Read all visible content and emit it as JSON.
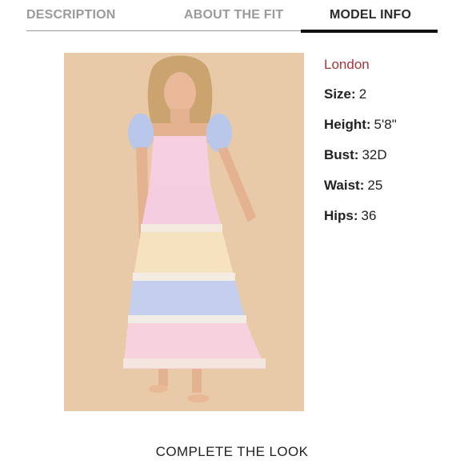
{
  "tabs": [
    {
      "label": "DESCRIPTION",
      "active": false
    },
    {
      "label": "ABOUT THE FIT",
      "active": false
    },
    {
      "label": "MODEL INFO",
      "active": true
    }
  ],
  "model": {
    "name": "London",
    "stats": [
      {
        "label": "Size:",
        "value": "2"
      },
      {
        "label": "Height:",
        "value": "5'8\""
      },
      {
        "label": "Bust:",
        "value": "32D"
      },
      {
        "label": "Waist:",
        "value": "25"
      },
      {
        "label": "Hips:",
        "value": "36"
      }
    ]
  },
  "footer": {
    "title": "COMPLETE THE LOOK"
  },
  "colors": {
    "model_name": "#a6343a",
    "photo_background": "#e7c9a6",
    "active_tab_underline": "#111111"
  }
}
